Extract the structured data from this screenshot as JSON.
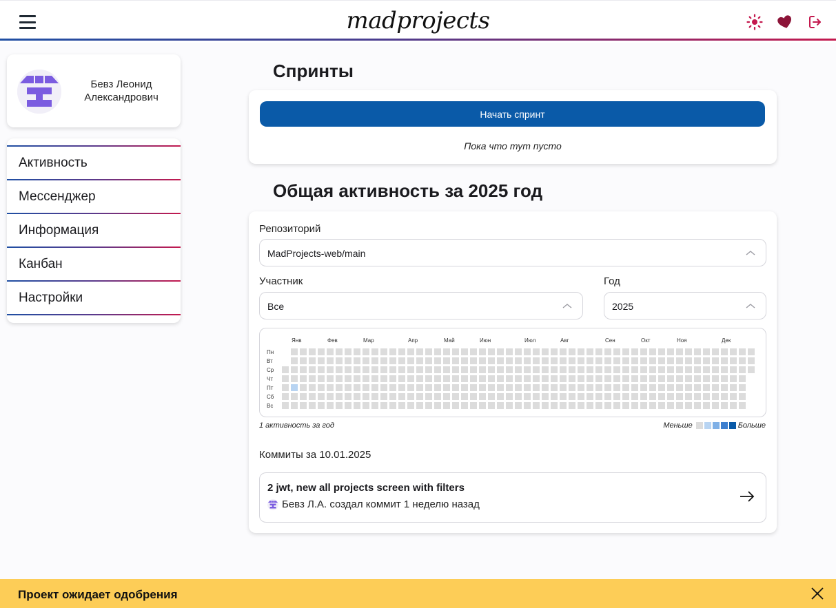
{
  "app": {
    "logo": "madprojects"
  },
  "header": {
    "icons": [
      "menu-icon",
      "sun-icon",
      "heart-icon",
      "logout-icon"
    ]
  },
  "profile": {
    "name": "Бевз Леонид Александрович"
  },
  "sidebar": {
    "items": [
      {
        "label": "Активность"
      },
      {
        "label": "Мессенджер"
      },
      {
        "label": "Информация"
      },
      {
        "label": "Канбан"
      },
      {
        "label": "Настройки"
      }
    ]
  },
  "sprints": {
    "title": "Спринты",
    "start_button": "Начать спринт",
    "empty_text": "Пока что тут пусто"
  },
  "activity": {
    "title": "Общая активность за 2025 год",
    "repository": {
      "label": "Репозиторий",
      "value": "MadProjects-web/main"
    },
    "participant": {
      "label": "Участник",
      "value": "Все"
    },
    "year": {
      "label": "Год",
      "value": "2025"
    },
    "caption": "1 активность за год",
    "legend": {
      "less": "Меньше",
      "more": "Больше",
      "colors": [
        "#dcdcdc",
        "#b8d4f2",
        "#7fb0e6",
        "#3d7fcf",
        "#0a5aa8"
      ]
    },
    "heatmap": {
      "months": [
        "Янв",
        "Фев",
        "Мар",
        "Апр",
        "Май",
        "Июн",
        "Июл",
        "Авг",
        "Сен",
        "Окт",
        "Ноя",
        "Дек"
      ],
      "days": [
        "Пн",
        "Вт",
        "Ср",
        "Чт",
        "Пт",
        "Сб",
        "Вс"
      ],
      "first_weekday_index": 2,
      "days_in_year": 365,
      "active_days": [
        {
          "day_index": 9,
          "level": 1
        }
      ]
    },
    "commits_title": "Коммиты за 10.01.2025",
    "commit": {
      "title": "2 jwt, new all projects screen with filters",
      "meta": "Бевз Л.А. создал коммит 1 неделю назад"
    }
  },
  "banner": {
    "text": "Проект ожидает одобрения"
  }
}
